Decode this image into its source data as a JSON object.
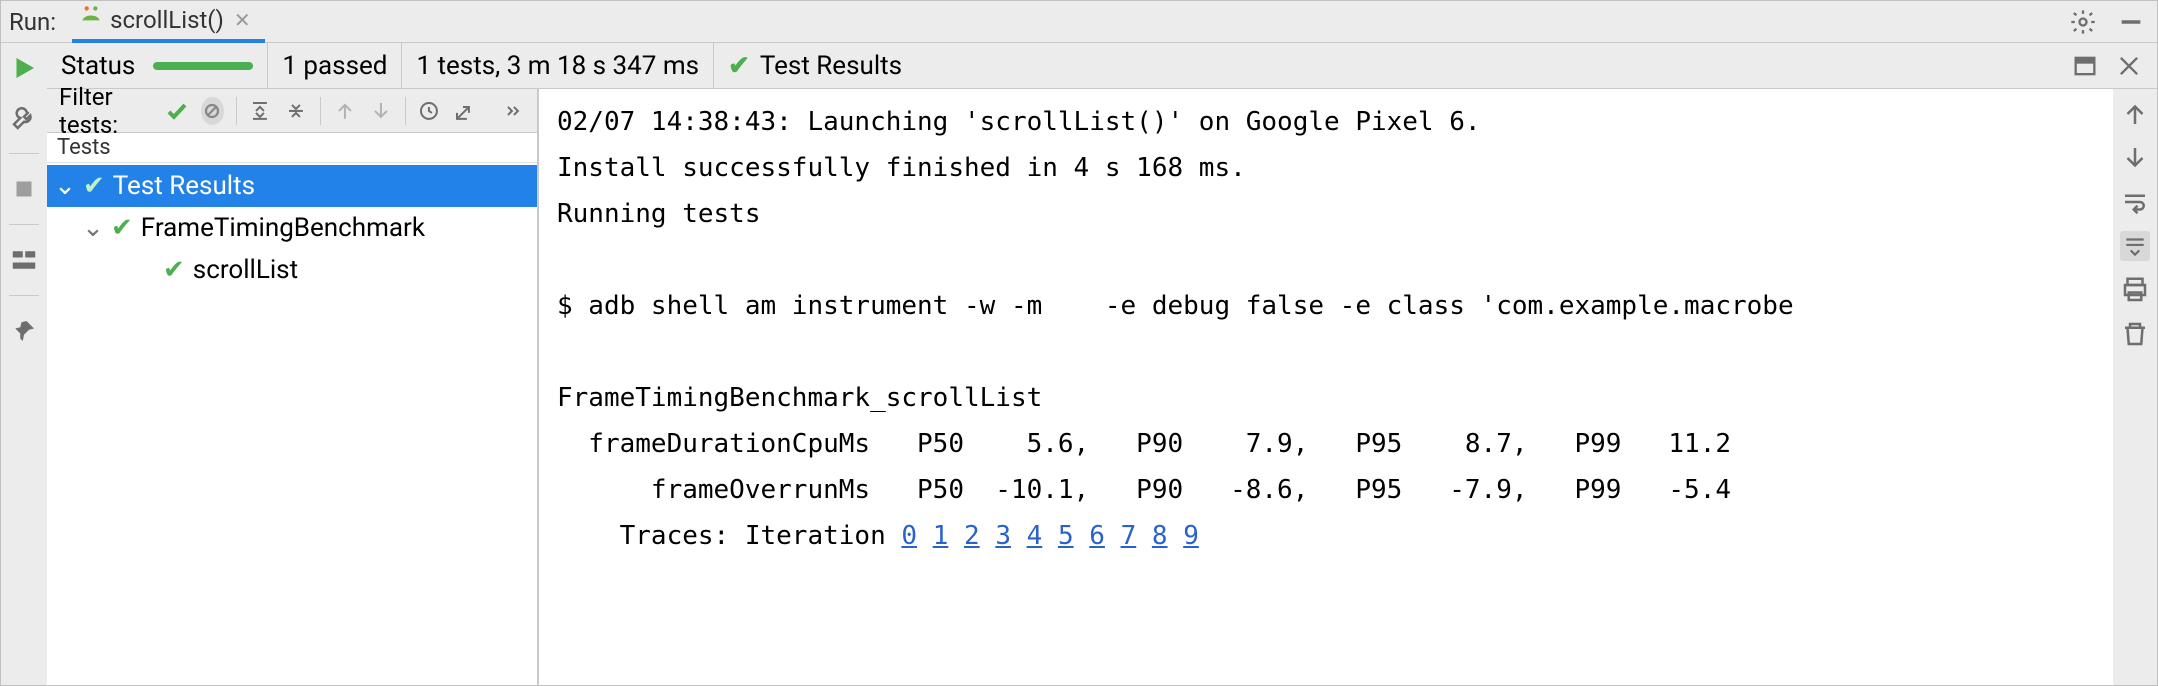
{
  "header": {
    "run_label": "Run:",
    "tab_title": "scrollList()"
  },
  "status": {
    "label": "Status",
    "passed": "1 passed",
    "summary": "1 tests, 3 m 18 s 347 ms",
    "results_title": "Test Results"
  },
  "toolbar": {
    "filter_label": "Filter tests:"
  },
  "tree": {
    "header": "Tests",
    "root": "Test Results",
    "nodes": [
      {
        "label": "FrameTimingBenchmark"
      },
      {
        "label": "scrollList"
      }
    ]
  },
  "console": {
    "line1": "02/07 14:38:43: Launching 'scrollList()' on Google Pixel 6.",
    "line2": "Install successfully finished in 4 s 168 ms.",
    "line3": "Running tests",
    "line4": "",
    "line5": "$ adb shell am instrument -w -m    -e debug false -e class 'com.example.macrobe",
    "line6": "",
    "line7": "FrameTimingBenchmark_scrollList",
    "line8": "  frameDurationCpuMs   P50    5.6,   P90    7.9,   P95    8.7,   P99   11.2",
    "line9": "      frameOverrunMs   P50  -10.1,   P90   -8.6,   P95   -7.9,   P99   -5.4",
    "traces_prefix": "    Traces: Iteration ",
    "traces": [
      "0",
      "1",
      "2",
      "3",
      "4",
      "5",
      "6",
      "7",
      "8",
      "9"
    ]
  },
  "chart_data": {
    "type": "table",
    "title": "FrameTimingBenchmark_scrollList",
    "columns": [
      "metric",
      "P50",
      "P90",
      "P95",
      "P99"
    ],
    "rows": [
      {
        "metric": "frameDurationCpuMs",
        "P50": 5.6,
        "P90": 7.9,
        "P95": 8.7,
        "P99": 11.2
      },
      {
        "metric": "frameOverrunMs",
        "P50": -10.1,
        "P90": -8.6,
        "P95": -7.9,
        "P99": -5.4
      }
    ]
  }
}
